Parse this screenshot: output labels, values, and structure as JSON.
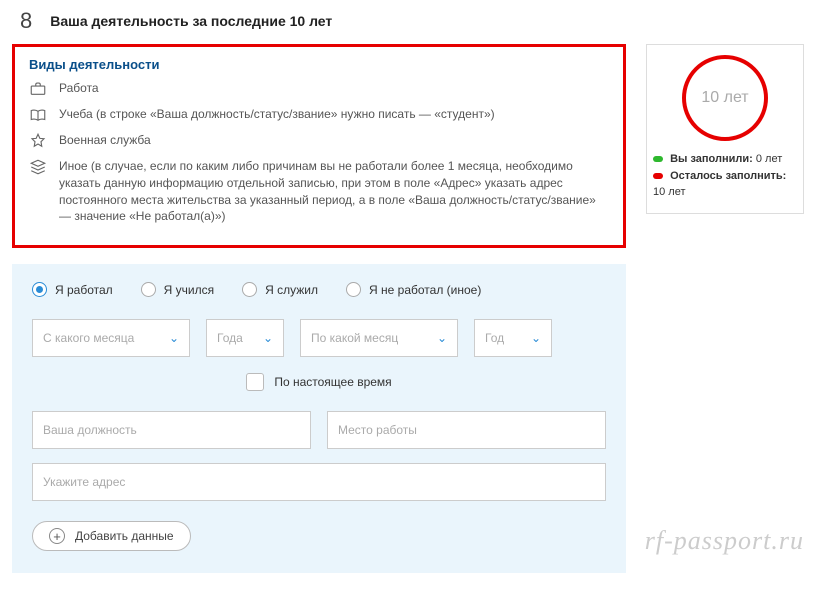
{
  "header": {
    "step_num": "8",
    "title": "Ваша деятельность за последние 10 лет"
  },
  "info": {
    "title": "Виды деятельности",
    "work": "Работа",
    "study": "Учеба (в строке «Ваша должность/статус/звание» нужно писать — «студент»)",
    "army": "Военная служба",
    "other": "Иное (в случае, если по каким либо причинам вы не работали более 1 месяца, необходимо указать данную информацию отдельной записью, при этом в поле «Адрес» указать адрес постоянного места жительства за указанный период, а в поле «Ваша должность/статус/звание» — значение «Не работал(а)»)"
  },
  "gauge": {
    "center": "10 лет",
    "filled_label": "Вы заполнили:",
    "filled_val": "0 лет",
    "remain_label": "Осталось заполнить:",
    "remain_val": "10 лет"
  },
  "form": {
    "radios": {
      "r1": "Я работал",
      "r2": "Я учился",
      "r3": "Я служил",
      "r4": "Я не работал (иное)"
    },
    "from_month": "С какого месяца",
    "from_year": "Года",
    "to_month": "По какой месяц",
    "to_year": "Год",
    "present": "По настоящее время",
    "position": "Ваша должность",
    "place": "Место работы",
    "address": "Укажите адрес",
    "add": "Добавить данные"
  },
  "watermark": "rf-passport.ru"
}
